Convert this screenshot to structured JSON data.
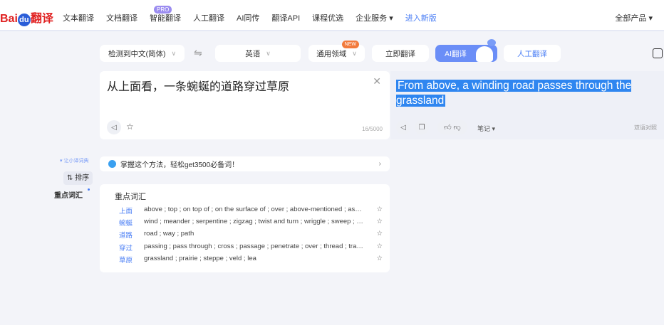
{
  "header": {
    "logo": "Baidu翻译",
    "logo_left": "Bai",
    "logo_du": "du",
    "logo_right": "翻译",
    "nav": [
      "文本翻译",
      "文档翻译",
      "智能翻译",
      "人工翻译",
      "AI同传",
      "翻译API",
      "课程优选",
      "企业服务 ▾",
      "进入新版"
    ],
    "pro_badge": "PRO",
    "all_products": "全部产品 ▾"
  },
  "toolbar": {
    "source_lang": "检测到中文(简体)",
    "swap": "⇋",
    "target_lang": "英语",
    "domain": "通用领域",
    "new_badge": "NEW",
    "translate_now": "立即翻译",
    "ai_translate": "AI翻译",
    "human_translate": "人工翻译"
  },
  "source": {
    "text": "从上面看，一条蜿蜒的道路穿过草原",
    "count": "16/5000"
  },
  "target": {
    "text": "From above, a winding road passes through the grassland",
    "notes": "笔记 ▾",
    "bilingual": "双语对照"
  },
  "sidebar": {
    "dict": "让小译词典",
    "sort": "排序",
    "key_vocab": "重点词汇"
  },
  "tip": "掌握这个方法，轻松get3500必备词！",
  "vocab": {
    "title": "重点词汇",
    "items": [
      {
        "word": "上面",
        "def": "above ; top ; on top of ; on the surface of ; over ; above-mentioned ; aspect"
      },
      {
        "word": "蜿蜒",
        "def": "wind ; meander ; serpentine ; zigzag ; twist and turn ; wriggle ; sweep ; snake"
      },
      {
        "word": "道路",
        "def": "road ; way ; path"
      },
      {
        "word": "穿过",
        "def": "passing ; pass through ; cross ; passage ; penetrate ; over ; thread ; traverse"
      },
      {
        "word": "草原",
        "def": "grassland ; prairie ; steppe ; veld ; lea"
      }
    ]
  }
}
